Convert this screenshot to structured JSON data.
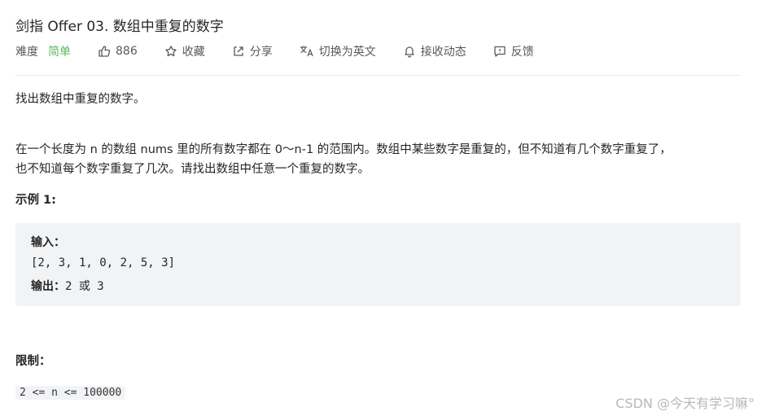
{
  "problem": {
    "title": "剑指 Offer 03. 数组中重复的数字"
  },
  "toolbar": {
    "difficulty_label": "难度",
    "difficulty_value": "简单",
    "likes": "886",
    "favorite": "收藏",
    "share": "分享",
    "switch_lang": "切换为英文",
    "follow": "接收动态",
    "feedback": "反馈"
  },
  "content": {
    "intro": "找出数组中重复的数字。",
    "desc_line1": "在一个长度为 n 的数组 nums 里的所有数字都在 0～n-1 的范围内。数组中某些数字是重复的，但不知道有几个数字重复了，",
    "desc_line2": "也不知道每个数字重复了几次。请找出数组中任意一个重复的数字。",
    "example_title": "示例 1:",
    "example": {
      "input_label": "输入：",
      "input_value": "[2, 3, 1, 0, 2, 5, 3]",
      "output_label": "输出：",
      "output_value": "2 或 3"
    },
    "limit_title": "限制：",
    "limit_value": "2 <= n <= 100000"
  },
  "watermark": "CSDN @今天有学习嘛°",
  "colors": {
    "difficulty_easy": "#5cb85c",
    "code_bg": "#f2f3f5"
  }
}
